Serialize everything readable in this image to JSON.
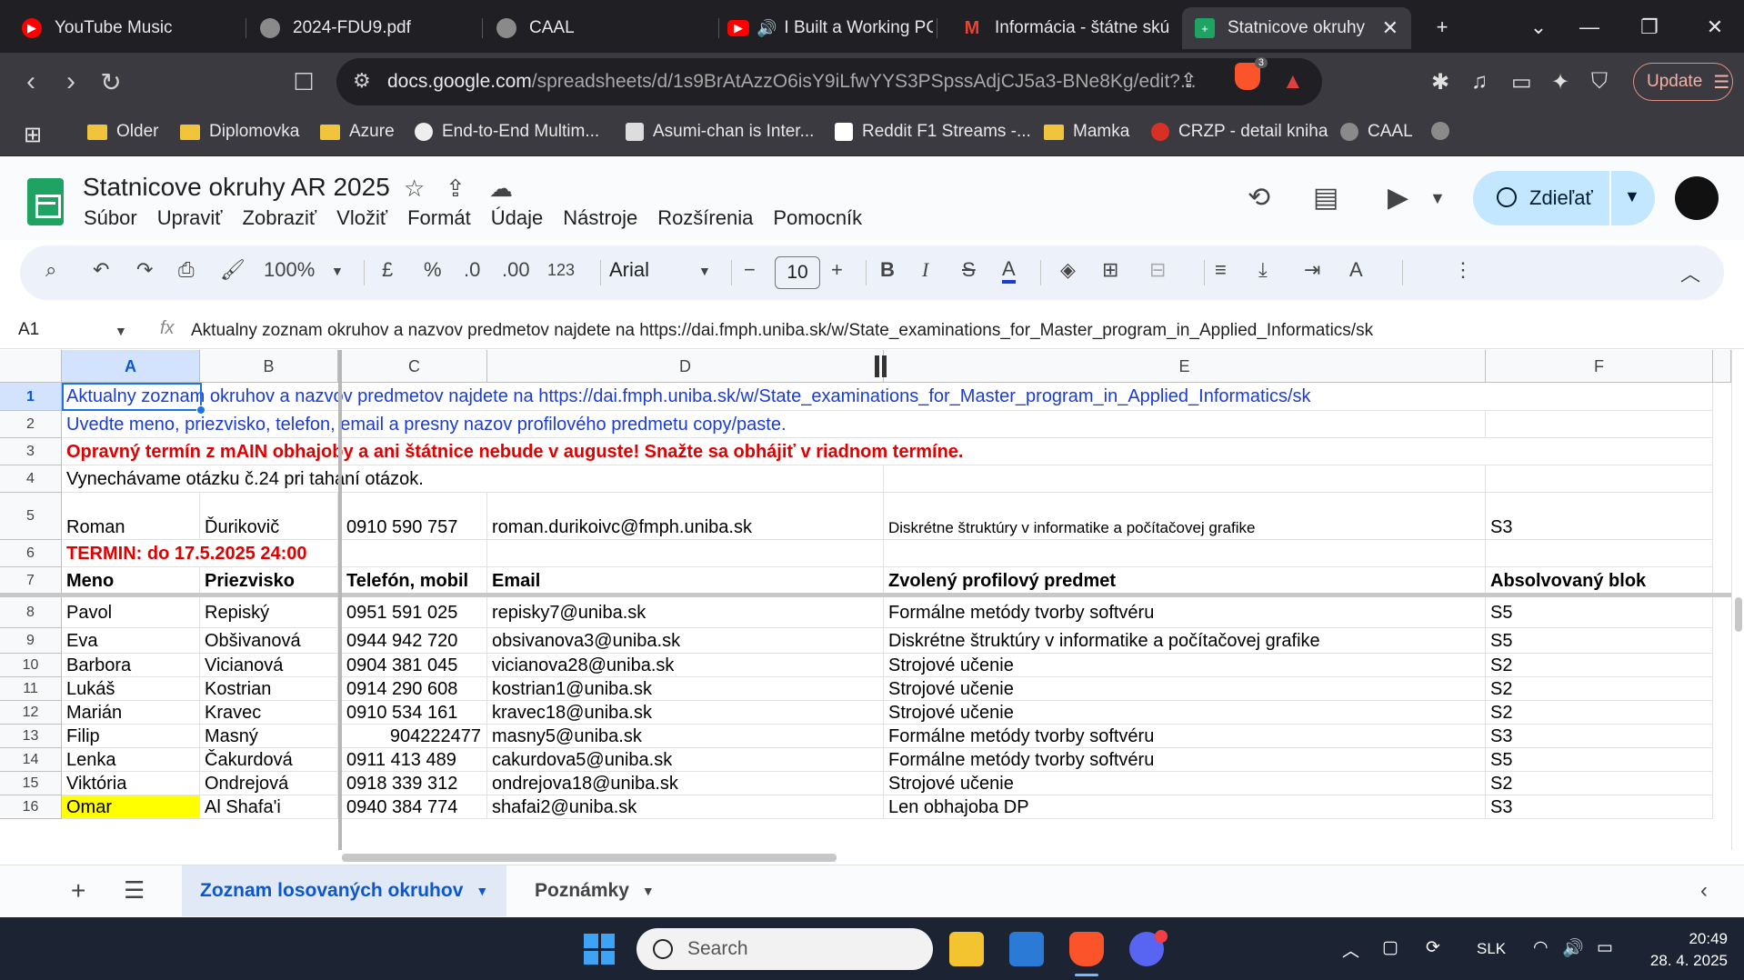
{
  "browser": {
    "tabs": [
      {
        "title": "YouTube Music"
      },
      {
        "title": "2024-FDU9.pdf"
      },
      {
        "title": "CAAL"
      },
      {
        "title": "I Built a Working PC"
      },
      {
        "title": "Informácia - štátne skú"
      },
      {
        "title": "Statnicove okruhy"
      }
    ],
    "url_host": "docs.google.com",
    "url_path": "/spreadsheets/d/1s9BrAtAzzO6isY9iLfwYYS3PSpssAdjCJ5a3-BNe8Kg/edit?...",
    "brave_count": "3",
    "update_label": "Update",
    "bookmarks": [
      "Older",
      "Diplomovka",
      "Azure",
      "End-to-End Multim...",
      "Asumi-chan is Inter...",
      "Reddit F1 Streams -...",
      "Mamka",
      "CRZP - detail kniha",
      "CAAL"
    ]
  },
  "sheet": {
    "doc_title": "Statnicove okruhy AR 2025",
    "menu": [
      "Súbor",
      "Upraviť",
      "Zobraziť",
      "Vložiť",
      "Formát",
      "Údaje",
      "Nástroje",
      "Rozšírenia",
      "Pomocník"
    ],
    "share_label": "Zdieľať",
    "toolbar": {
      "zoom": "100%",
      "currency": "£",
      "percent": "%",
      "dec_less": ".0",
      "dec_more": ".00",
      "numformat": "123",
      "font": "Arial",
      "font_size": "10"
    },
    "name_box": "A1",
    "formula": "Aktualny zoznam okruhov a nazvov predmetov najdete na https://dai.fmph.uniba.sk/w/State_examinations_for_Master_program_in_Applied_Informatics/sk",
    "columns": [
      "A",
      "B",
      "C",
      "D",
      "E",
      "F"
    ],
    "rows": {
      "r1": "Aktualny zoznam okruhov a nazvov predmetov najdete na https://dai.fmph.uniba.sk/w/State_examinations_for_Master_program_in_Applied_Informatics/sk",
      "r2": "Uvedte meno, priezvisko, telefon, email a presny nazov profilového predmetu copy/paste.",
      "r3": "Opravný termín z mAIN obhajoby a ani štátnice nebude v auguste! Snažte sa obhájiť v riadnom termíne.",
      "r4": "Vynechávame otázku č.24 pri tahaní otázok.",
      "r6": "TERMIN: do 17.5.2025 24:00"
    },
    "row5": {
      "meno": "Roman",
      "priezvisko": "Ďurikovič",
      "telefon": "0910 590 757",
      "email": "roman.durikoivc@fmph.uniba.sk",
      "predmet": "Diskrétne štruktúry v informatike a počítačovej grafike",
      "blok": "S3"
    },
    "header": {
      "meno": "Meno",
      "priezvisko": "Priezvisko",
      "telefon": "Telefón, mobil",
      "email": "Email",
      "predmet": "Zvolený profilový predmet",
      "blok": "Absolvovaný blok"
    },
    "students": [
      {
        "row": "8",
        "meno": "Pavol",
        "priezvisko": "Repiský",
        "telefon": "0951 591 025",
        "email": "repisky7@uniba.sk",
        "predmet": "Formálne metódy tvorby softvéru",
        "blok": "S5"
      },
      {
        "row": "9",
        "meno": "Eva",
        "priezvisko": "Obšivanová",
        "telefon": "0944 942 720",
        "email": "obsivanova3@uniba.sk",
        "predmet": "Diskrétne štruktúry v informatike a počítačovej grafike",
        "blok": "S5"
      },
      {
        "row": "10",
        "meno": "Barbora",
        "priezvisko": "Vicianová",
        "telefon": "0904 381 045",
        "email": "vicianova28@uniba.sk",
        "predmet": "Strojové učenie",
        "blok": "S2"
      },
      {
        "row": "11",
        "meno": "Lukáš",
        "priezvisko": "Kostrian",
        "telefon": "0914 290 608",
        "email": "kostrian1@uniba.sk",
        "predmet": "Strojové učenie",
        "blok": "S2"
      },
      {
        "row": "12",
        "meno": "Marián",
        "priezvisko": "Kravec",
        "telefon": "0910 534 161",
        "email": "kravec18@uniba.sk",
        "predmet": "Strojové učenie",
        "blok": "S2"
      },
      {
        "row": "13",
        "meno": "Filip",
        "priezvisko": "Masný",
        "telefon": "904222477",
        "email": "masny5@uniba.sk",
        "predmet": "Formálne metódy tvorby softvéru",
        "blok": "S3"
      },
      {
        "row": "14",
        "meno": "Lenka",
        "priezvisko": "Čakurdová",
        "telefon": "0911 413 489",
        "email": "cakurdova5@uniba.sk",
        "predmet": "Formálne metódy tvorby softvéru",
        "blok": "S5"
      },
      {
        "row": "15",
        "meno": "Viktória",
        "priezvisko": "Ondrejová",
        "telefon": "0918 339 312",
        "email": "ondrejova18@uniba.sk",
        "predmet": "Strojové učenie",
        "blok": "S2"
      },
      {
        "row": "16",
        "meno": "Omar",
        "priezvisko": "Al Shafa'i",
        "telefon": "0940 384 774",
        "email": "shafai2@uniba.sk",
        "predmet": "Len obhajoba DP",
        "blok": "S3"
      }
    ],
    "sheet_tabs": [
      "Zoznam losovaných okruhov",
      "Poznámky"
    ],
    "colors": {
      "link_blue": "#1a3bd6",
      "alert_red": "#e00000",
      "highlight": "#ffff00",
      "accent": "#0b57d0"
    }
  },
  "taskbar": {
    "search_placeholder": "Search",
    "lang": "SLK",
    "time": "20:49",
    "date": "28. 4. 2025"
  }
}
